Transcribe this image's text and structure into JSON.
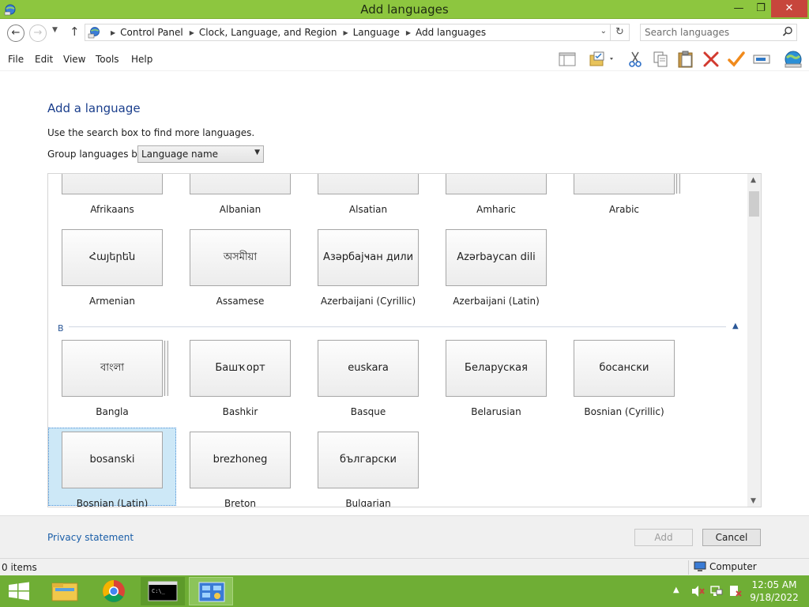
{
  "window": {
    "title": "Add languages",
    "controls": {
      "minimize": "—",
      "maximize": "❐",
      "close": "✕"
    }
  },
  "address": {
    "breadcrumbs": [
      "Control Panel",
      "Clock, Language, and Region",
      "Language",
      "Add languages"
    ],
    "search_placeholder": "Search languages"
  },
  "menu": {
    "items": [
      "File",
      "Edit",
      "View",
      "Tools",
      "Help"
    ]
  },
  "toolbar": {
    "icons": [
      "layout-icon",
      "properties-folder-icon",
      "cut-icon",
      "copy-icon",
      "paste-icon",
      "delete-icon",
      "check-icon",
      "rename-icon",
      "globe-icon"
    ]
  },
  "page": {
    "heading": "Add a language",
    "instruction": "Use the search box to find more languages.",
    "group_label": "Group languages by:",
    "group_value": "Language name"
  },
  "languages": {
    "row_a1": [
      {
        "native": "",
        "name": "Afrikaans"
      },
      {
        "native": "",
        "name": "Albanian"
      },
      {
        "native": "",
        "name": "Alsatian"
      },
      {
        "native": "",
        "name": "Amharic"
      },
      {
        "native": "",
        "name": "Arabic"
      }
    ],
    "row_a2": [
      {
        "native": "Հայերեն",
        "name": "Armenian"
      },
      {
        "native": "অসমীয়া",
        "name": "Assamese"
      },
      {
        "native": "Азәрбајҹан дили",
        "name": "Azerbaijani (Cyrillic)"
      },
      {
        "native": "Azərbaycan dili",
        "name": "Azerbaijani (Latin)"
      }
    ],
    "group_b": "B",
    "row_b1": [
      {
        "native": "বাংলা",
        "name": "Bangla"
      },
      {
        "native": "Башҡорт",
        "name": "Bashkir"
      },
      {
        "native": "euskara",
        "name": "Basque"
      },
      {
        "native": "Беларуская",
        "name": "Belarusian"
      },
      {
        "native": "босански",
        "name": "Bosnian (Cyrillic)"
      }
    ],
    "row_b2": [
      {
        "native": "bosanski",
        "name": "Bosnian (Latin)"
      },
      {
        "native": "brezhoneg",
        "name": "Breton"
      },
      {
        "native": "български",
        "name": "Bulgarian"
      }
    ],
    "selected": "Bosnian (Latin)"
  },
  "footer": {
    "privacy": "Privacy statement",
    "add": "Add",
    "cancel": "Cancel"
  },
  "status": {
    "items": "0 items",
    "location": "Computer"
  },
  "taskbar": {
    "time": "12:05 AM",
    "date": "9/18/2022",
    "accent": "#6fae35"
  }
}
